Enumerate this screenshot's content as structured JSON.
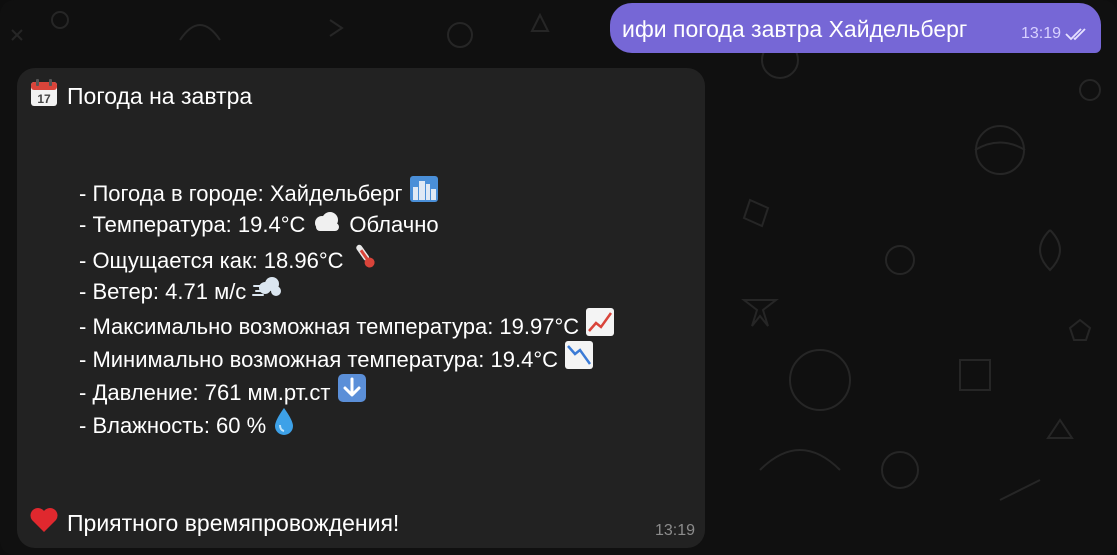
{
  "outgoing": {
    "text": "ифи погода завтра Хайдельберг",
    "time": "13:19",
    "status_icon": "double-check-icon"
  },
  "incoming": {
    "title": "Погода на завтра",
    "title_icon": "calendar-icon",
    "lines": [
      {
        "text": "- Погода в городе: Хайдельберг",
        "icon": "cityscape-icon"
      },
      {
        "text": "- Температура: 19.4°C",
        "icon": "cloud-icon",
        "suffix": "Облачно"
      },
      {
        "text": "- Ощущается как: 18.96°C",
        "icon": "thermometer-icon"
      },
      {
        "text": "- Ветер: 4.71 м/с",
        "icon": "wind-icon"
      },
      {
        "text": "- Максимально возможная температура: 19.97°C",
        "icon": "chart-increasing-icon"
      },
      {
        "text": "- Минимально возможная температура: 19.4°C",
        "icon": "chart-decreasing-icon"
      },
      {
        "text": "- Давление: 761 мм.рт.ст",
        "icon": "down-arrow-icon"
      },
      {
        "text": "- Влажность: 60 %",
        "icon": "droplet-icon"
      }
    ],
    "footer": "Приятного времяпровождения!",
    "footer_icon": "heart-icon",
    "time": "13:19"
  },
  "colors": {
    "outgoing_bubble": "#7667d6",
    "incoming_bubble": "#222222",
    "background": "#101010"
  }
}
